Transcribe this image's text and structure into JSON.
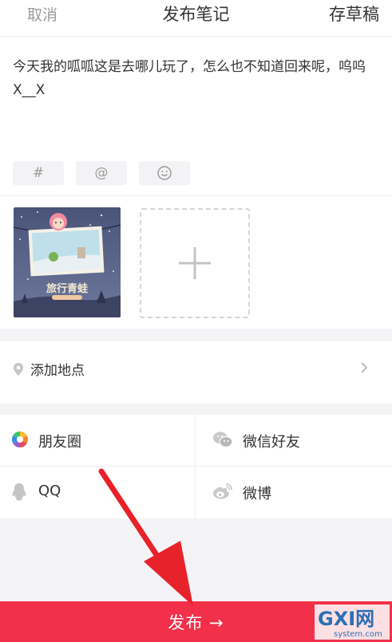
{
  "header": {
    "cancel_label": "取消",
    "title": "发布笔记",
    "draft_label": "存草稿"
  },
  "post": {
    "text": "今天我的呱呱这是去哪儿玩了，怎么也不知道回来呢，呜呜X__X"
  },
  "tools": {
    "hash": "#",
    "at": "@",
    "emoji": "emoji-icon"
  },
  "photo": {
    "caption": "旅行青蛙",
    "sub": "旅行青蛙"
  },
  "location": {
    "label": "添加地点"
  },
  "share": {
    "moments": "朋友圈",
    "wechat_friend": "微信好友",
    "qq": "QQ",
    "weibo": "微博"
  },
  "publish": {
    "label": "发布 →"
  },
  "colors": {
    "accent": "#f2304a",
    "arrow": "#e8222a"
  },
  "watermark": {
    "brand": "GXI网",
    "url": "system.com"
  }
}
